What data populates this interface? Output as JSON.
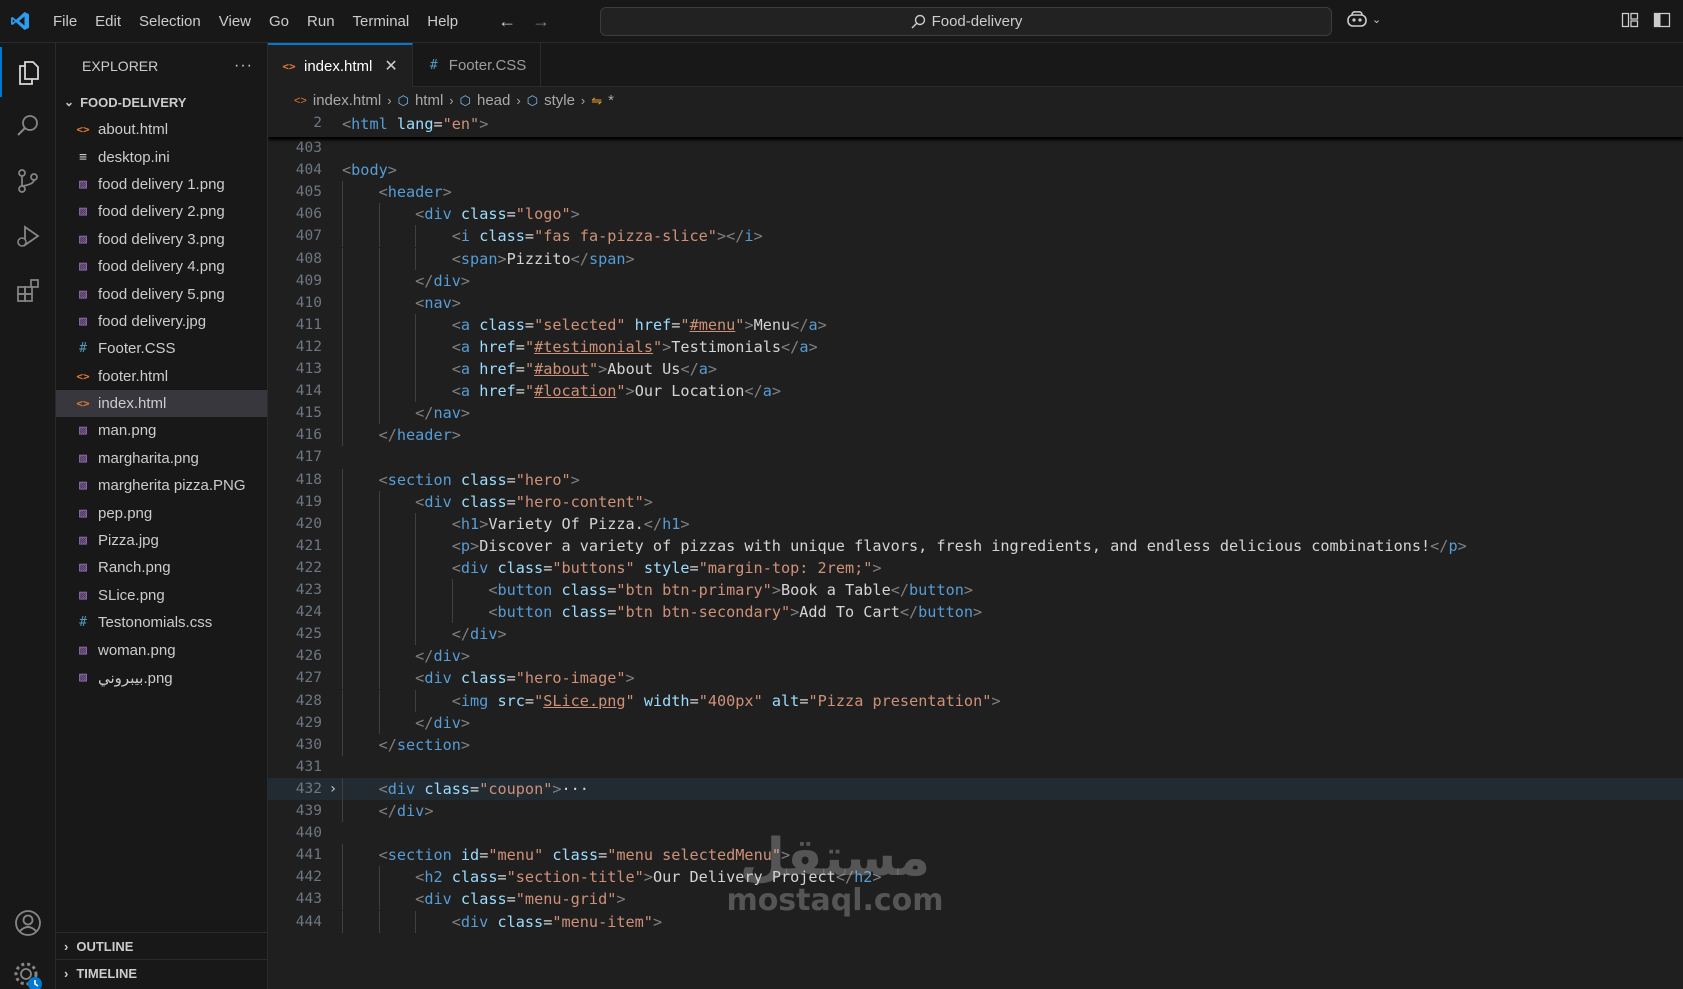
{
  "titlebar": {
    "menus": [
      "File",
      "Edit",
      "Selection",
      "View",
      "Go",
      "Run",
      "Terminal",
      "Help"
    ],
    "search_text": "Food-delivery"
  },
  "sidebar": {
    "title": "EXPLORER",
    "more": "···",
    "project": "FOOD-DELIVERY",
    "files": [
      {
        "name": "about.html",
        "icon": "html"
      },
      {
        "name": "desktop.ini",
        "icon": "ini"
      },
      {
        "name": "food delivery 1.png",
        "icon": "img"
      },
      {
        "name": "food delivery 2.png",
        "icon": "img"
      },
      {
        "name": "food delivery 3.png",
        "icon": "img"
      },
      {
        "name": "food delivery 4.png",
        "icon": "img"
      },
      {
        "name": "food delivery 5.png",
        "icon": "img"
      },
      {
        "name": "food delivery.jpg",
        "icon": "img"
      },
      {
        "name": "Footer.CSS",
        "icon": "css"
      },
      {
        "name": "footer.html",
        "icon": "html"
      },
      {
        "name": "index.html",
        "icon": "html",
        "selected": true
      },
      {
        "name": "man.png",
        "icon": "img"
      },
      {
        "name": "margharita.png",
        "icon": "img"
      },
      {
        "name": "margherita pizza.PNG",
        "icon": "img"
      },
      {
        "name": "pep.png",
        "icon": "img"
      },
      {
        "name": "Pizza.jpg",
        "icon": "img"
      },
      {
        "name": "Ranch.png",
        "icon": "img"
      },
      {
        "name": "SLice.png",
        "icon": "img"
      },
      {
        "name": "Testonomials.css",
        "icon": "css"
      },
      {
        "name": "woman.png",
        "icon": "img"
      },
      {
        "name": "بيبروني.png",
        "icon": "img"
      }
    ],
    "outline_label": "OUTLINE",
    "timeline_label": "TIMELINE"
  },
  "editor": {
    "tabs": [
      {
        "label": "index.html",
        "active": true,
        "icon": "html"
      },
      {
        "label": "Footer.CSS",
        "active": false,
        "icon": "css"
      }
    ],
    "breadcrumb": [
      "index.html",
      "html",
      "head",
      "style",
      "*"
    ],
    "sticky": {
      "num": "2",
      "code": "<html lang=\"en\">"
    },
    "lines": [
      {
        "num": "403",
        "code": ""
      },
      {
        "num": "404",
        "code": "<body>"
      },
      {
        "num": "405",
        "code": "    <header>"
      },
      {
        "num": "406",
        "code": "        <div class=\"logo\">"
      },
      {
        "num": "407",
        "code": "            <i class=\"fas fa-pizza-slice\"></i>"
      },
      {
        "num": "408",
        "code": "            <span>Pizzito</span>"
      },
      {
        "num": "409",
        "code": "        </div>"
      },
      {
        "num": "410",
        "code": "        <nav>"
      },
      {
        "num": "411",
        "code": "            <a class=\"selected\" href=\"#menu\">Menu</a>"
      },
      {
        "num": "412",
        "code": "            <a href=\"#testimonials\">Testimonials</a>"
      },
      {
        "num": "413",
        "code": "            <a href=\"#about\">About Us</a>"
      },
      {
        "num": "414",
        "code": "            <a href=\"#location\">Our Location</a>"
      },
      {
        "num": "415",
        "code": "        </nav>"
      },
      {
        "num": "416",
        "code": "    </header>"
      },
      {
        "num": "417",
        "code": ""
      },
      {
        "num": "418",
        "code": "    <section class=\"hero\">"
      },
      {
        "num": "419",
        "code": "        <div class=\"hero-content\">"
      },
      {
        "num": "420",
        "code": "            <h1>Variety Of Pizza.</h1>"
      },
      {
        "num": "421",
        "code": "            <p>Discover a variety of pizzas with unique flavors, fresh ingredients, and endless delicious combinations!</p>"
      },
      {
        "num": "422",
        "code": "            <div class=\"buttons\" style=\"margin-top: 2rem;\">"
      },
      {
        "num": "423",
        "code": "                <button class=\"btn btn-primary\">Book a Table</button>"
      },
      {
        "num": "424",
        "code": "                <button class=\"btn btn-secondary\">Add To Cart</button>"
      },
      {
        "num": "425",
        "code": "            </div>"
      },
      {
        "num": "426",
        "code": "        </div>"
      },
      {
        "num": "427",
        "code": "        <div class=\"hero-image\">"
      },
      {
        "num": "428",
        "code": "            <img src=\"SLice.png\" width=\"400px\" alt=\"Pizza presentation\">"
      },
      {
        "num": "429",
        "code": "        </div>"
      },
      {
        "num": "430",
        "code": "    </section>"
      },
      {
        "num": "431",
        "code": ""
      },
      {
        "num": "432",
        "code": "    <div class=\"coupon\">···",
        "folded": true
      },
      {
        "num": "439",
        "code": "    </div>"
      },
      {
        "num": "440",
        "code": ""
      },
      {
        "num": "441",
        "code": "    <section id=\"menu\" class=\"menu selectedMenu\">"
      },
      {
        "num": "442",
        "code": "        <h2 class=\"section-title\">Our Delivery Project</h2>"
      },
      {
        "num": "443",
        "code": "        <div class=\"menu-grid\">"
      },
      {
        "num": "444",
        "code": "            <div class=\"menu-item\">"
      }
    ]
  },
  "watermark": {
    "arabic": "مستقل",
    "latin": "mostaql.com"
  }
}
